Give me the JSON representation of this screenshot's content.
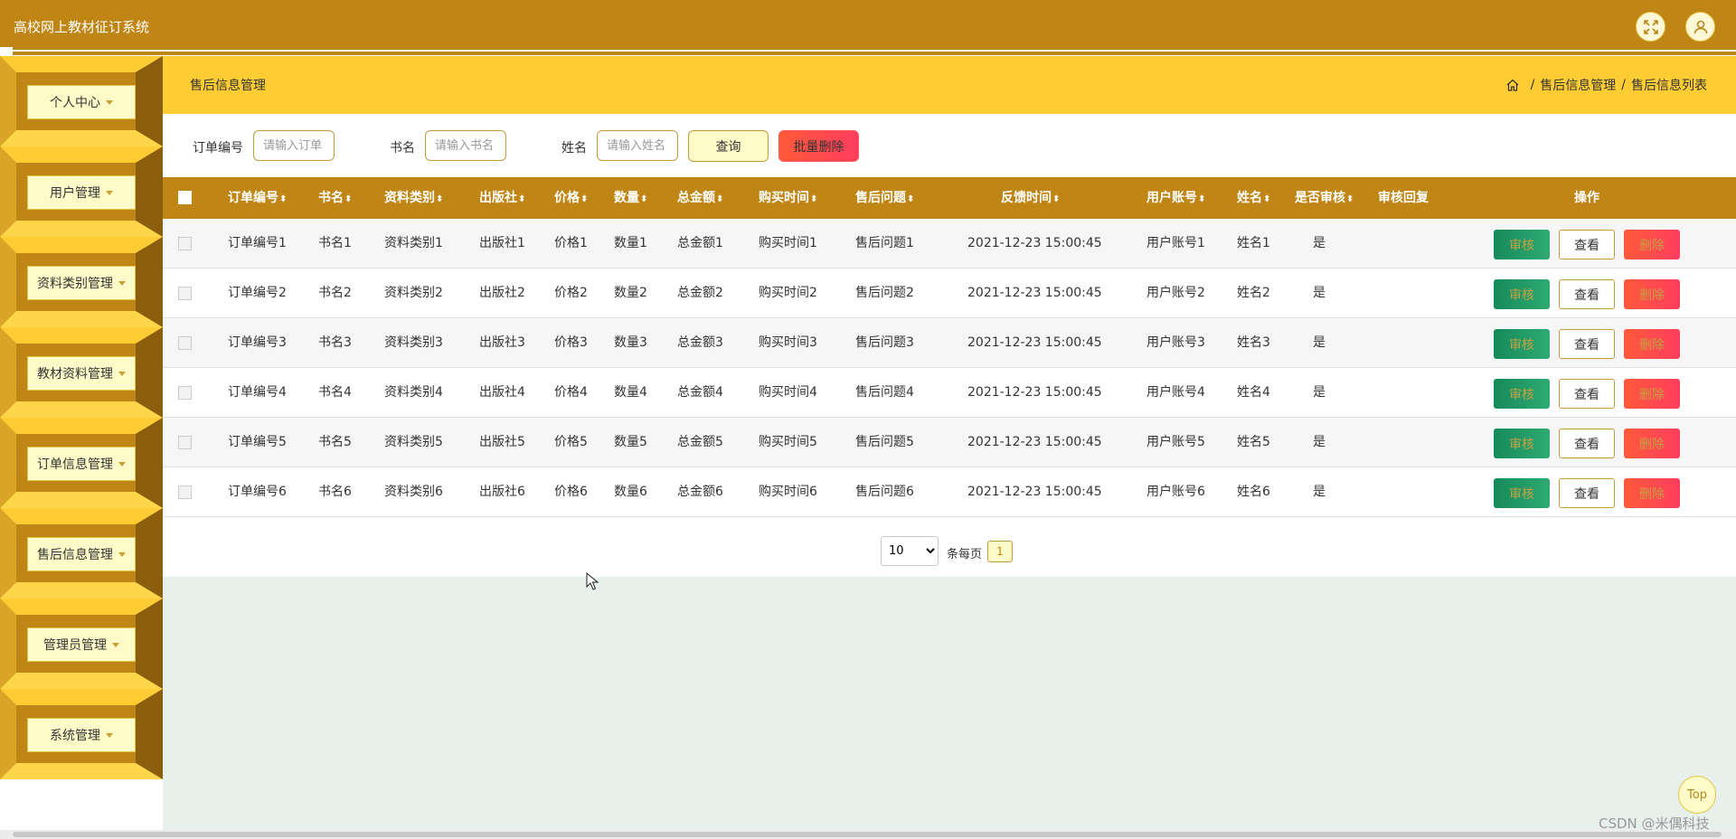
{
  "app": {
    "title": "高校网上教材征订系统"
  },
  "sidebar": {
    "items": [
      {
        "label": "个人中心"
      },
      {
        "label": "用户管理"
      },
      {
        "label": "资料类别管理"
      },
      {
        "label": "教材资料管理"
      },
      {
        "label": "订单信息管理"
      },
      {
        "label": "售后信息管理"
      },
      {
        "label": "管理员管理"
      },
      {
        "label": "系统管理"
      }
    ]
  },
  "header": {
    "page_title": "售后信息管理",
    "breadcrumb": [
      "售后信息管理",
      "售后信息列表"
    ],
    "breadcrumb_sep": "/"
  },
  "search": {
    "order_label": "订单编号",
    "order_placeholder": "请输入订单",
    "book_label": "书名",
    "book_placeholder": "请输入书名",
    "name_label": "姓名",
    "name_placeholder": "请输入姓名",
    "query_button": "查询",
    "batch_delete_button": "批量删除"
  },
  "table": {
    "columns": [
      "订单编号",
      "书名",
      "资料类别",
      "出版社",
      "价格",
      "数量",
      "总金额",
      "购买时间",
      "售后问题",
      "反馈时间",
      "用户账号",
      "姓名",
      "是否审核",
      "审核回复",
      "操作"
    ],
    "sort_glyph": "⬍",
    "rows": [
      [
        "订单编号1",
        "书名1",
        "资料类别1",
        "出版社1",
        "价格1",
        "数量1",
        "总金额1",
        "购买时间1",
        "售后问题1",
        "2021-12-23 15:00:45",
        "用户账号1",
        "姓名1",
        "是",
        ""
      ],
      [
        "订单编号2",
        "书名2",
        "资料类别2",
        "出版社2",
        "价格2",
        "数量2",
        "总金额2",
        "购买时间2",
        "售后问题2",
        "2021-12-23 15:00:45",
        "用户账号2",
        "姓名2",
        "是",
        ""
      ],
      [
        "订单编号3",
        "书名3",
        "资料类别3",
        "出版社3",
        "价格3",
        "数量3",
        "总金额3",
        "购买时间3",
        "售后问题3",
        "2021-12-23 15:00:45",
        "用户账号3",
        "姓名3",
        "是",
        ""
      ],
      [
        "订单编号4",
        "书名4",
        "资料类别4",
        "出版社4",
        "价格4",
        "数量4",
        "总金额4",
        "购买时间4",
        "售后问题4",
        "2021-12-23 15:00:45",
        "用户账号4",
        "姓名4",
        "是",
        ""
      ],
      [
        "订单编号5",
        "书名5",
        "资料类别5",
        "出版社5",
        "价格5",
        "数量5",
        "总金额5",
        "购买时间5",
        "售后问题5",
        "2021-12-23 15:00:45",
        "用户账号5",
        "姓名5",
        "是",
        ""
      ],
      [
        "订单编号6",
        "书名6",
        "资料类别6",
        "出版社6",
        "价格6",
        "数量6",
        "总金额6",
        "购买时间6",
        "售后问题6",
        "2021-12-23 15:00:45",
        "用户账号6",
        "姓名6",
        "是",
        ""
      ]
    ],
    "actions": {
      "audit": "审核",
      "view": "查看",
      "delete": "删除"
    }
  },
  "pager": {
    "page_size": "10",
    "page_size_options": [
      "10"
    ],
    "per_page_label": "条每页",
    "current_page": "1"
  },
  "misc": {
    "top_button": "Top",
    "watermark": "CSDN @米偶科技"
  },
  "colors": {
    "primary": "#bf8615",
    "header_bar": "#ffcc33",
    "button_light": "#fffbc8",
    "danger": "#ff4a48",
    "success": "#1f9a64",
    "content_bg": "#e8f0eb"
  },
  "icons": {
    "fullscreen": "fullscreen-icon",
    "user": "user-icon",
    "home": "home-icon",
    "caret": "caret-down-icon",
    "sort": "sort-icon"
  }
}
